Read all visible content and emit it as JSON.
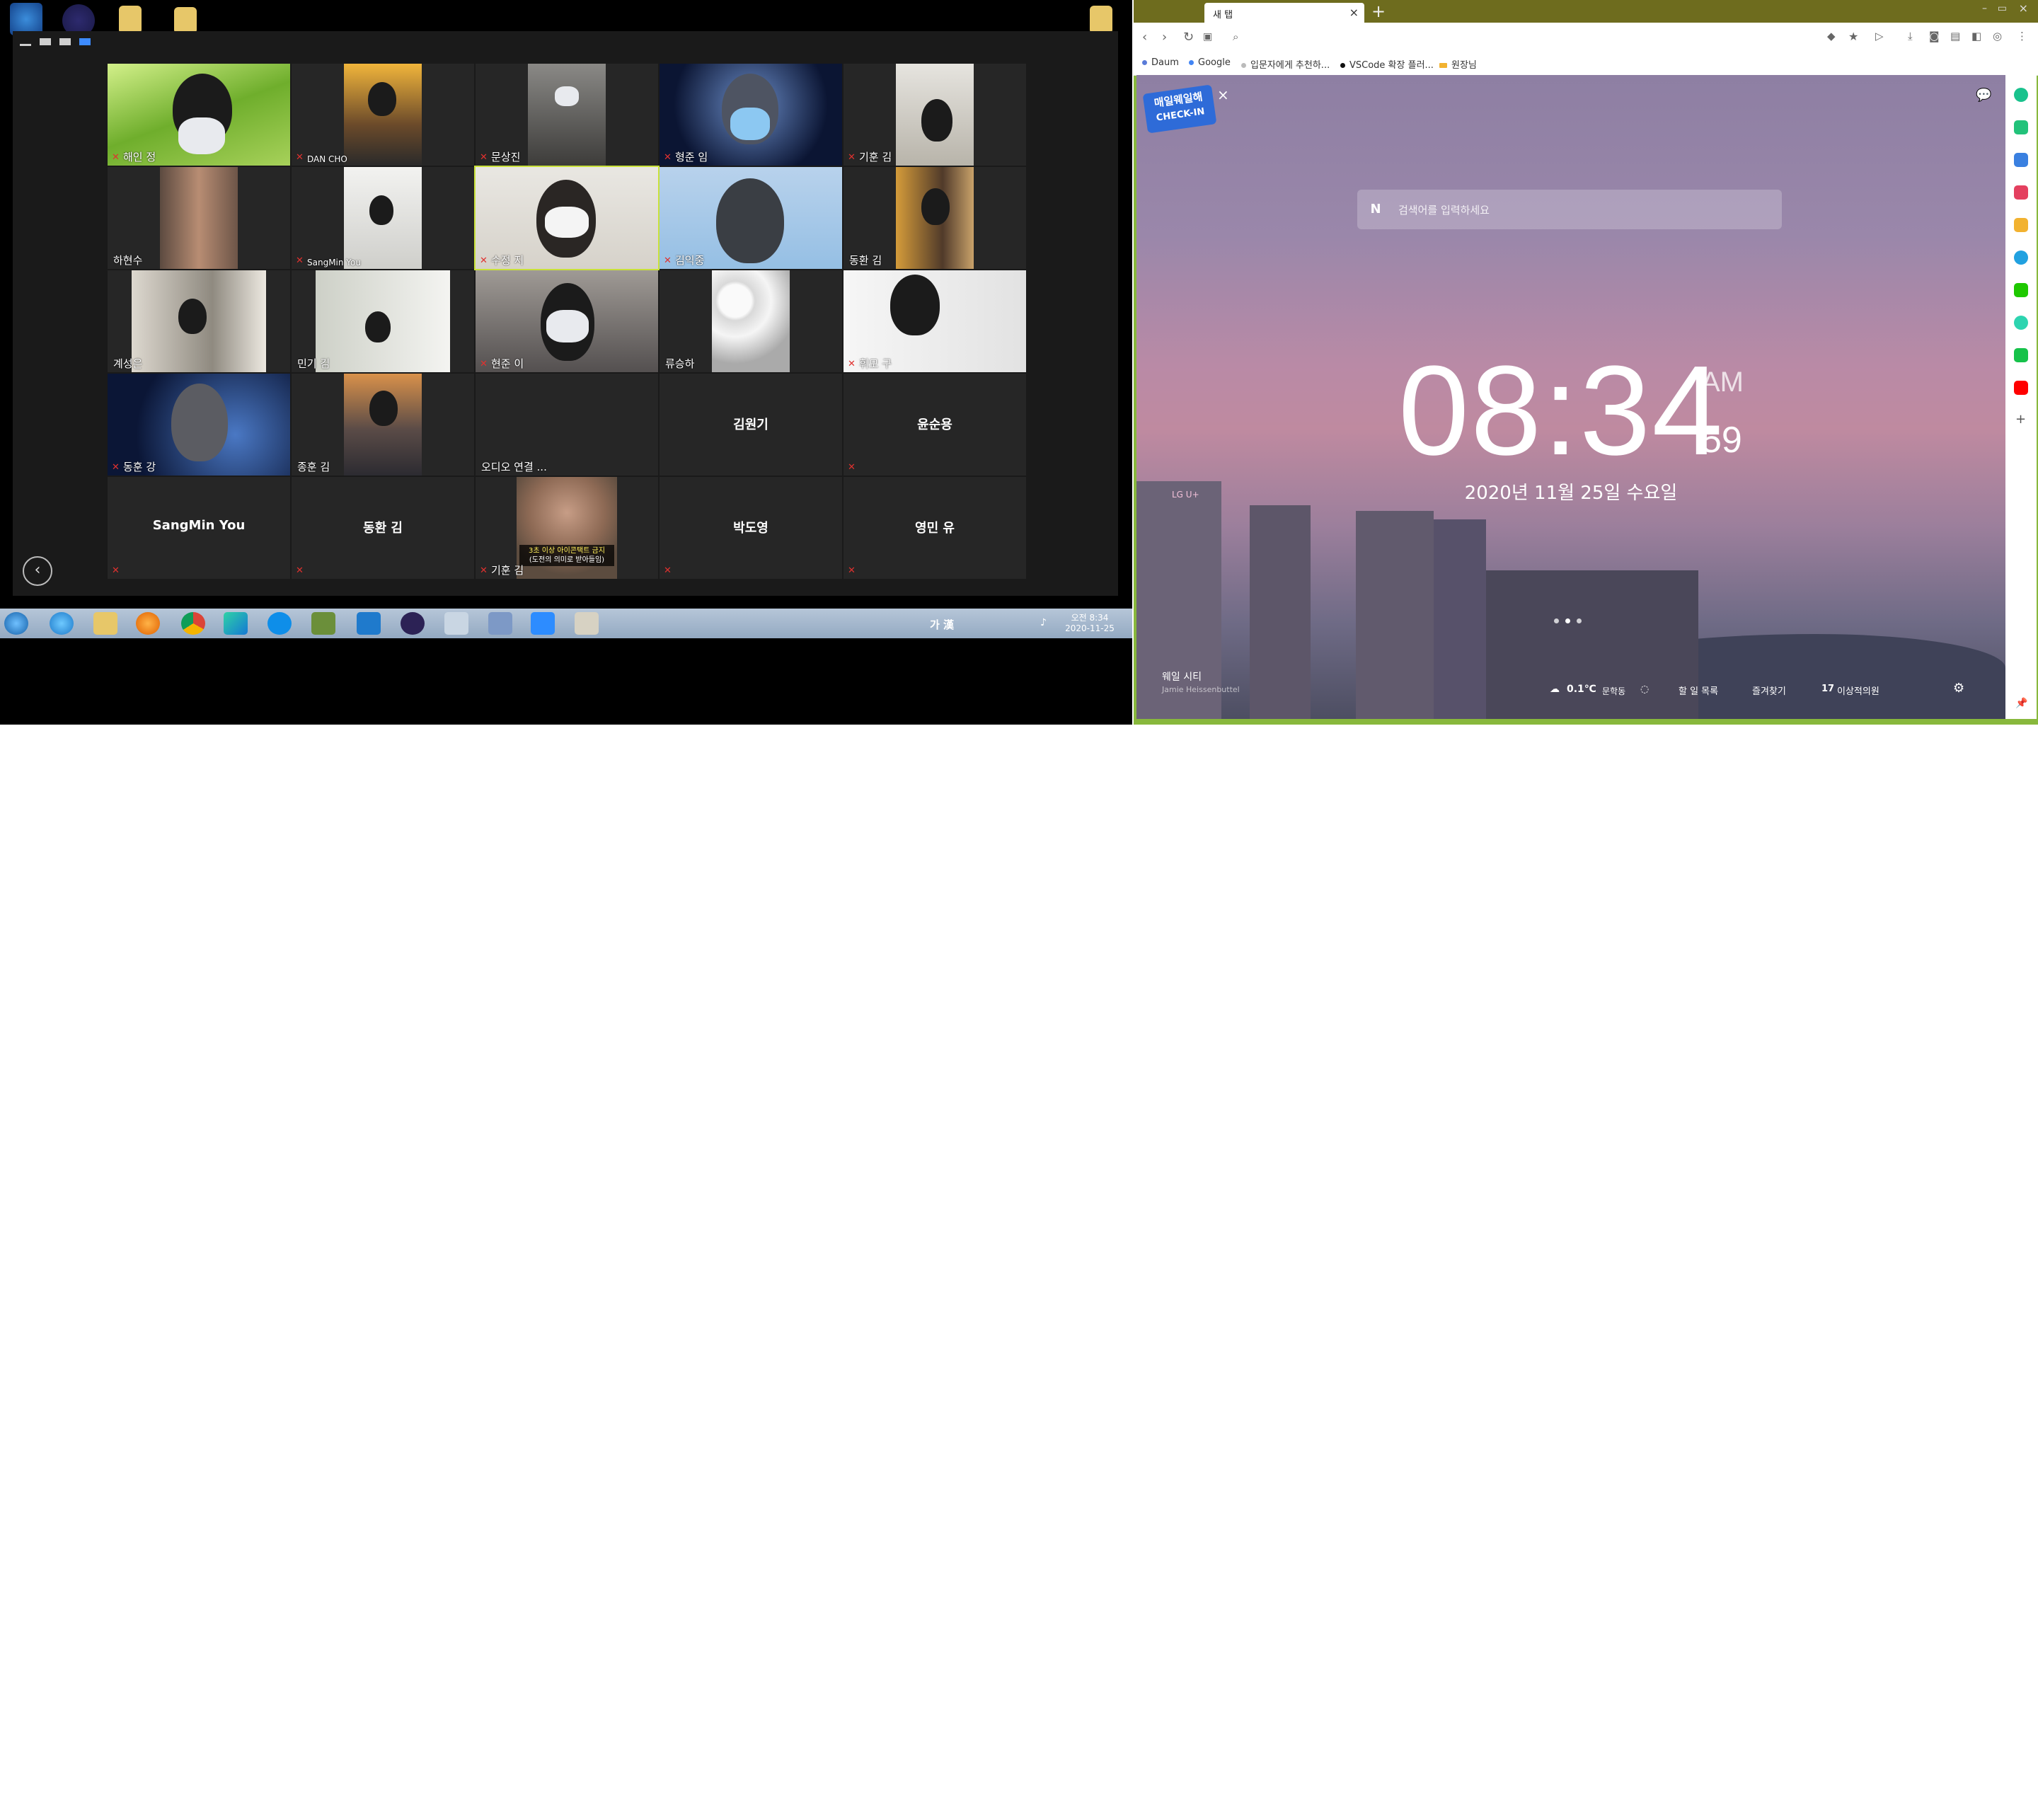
{
  "zoom": {
    "tiles": [
      {
        "name": "해인 정",
        "muted": true,
        "video": true
      },
      {
        "name": "DAN CHO",
        "muted": true,
        "video": true
      },
      {
        "name": "문상진",
        "muted": true,
        "video": true
      },
      {
        "name": "형준 임",
        "muted": true,
        "video": true
      },
      {
        "name": "기훈 김",
        "muted": true,
        "video": true
      },
      {
        "name": "하현수",
        "muted": false,
        "video": true
      },
      {
        "name": "SangMin You",
        "muted": true,
        "video": true
      },
      {
        "name": "수정 지",
        "muted": true,
        "video": true
      },
      {
        "name": "김익중",
        "muted": true,
        "video": true
      },
      {
        "name": "동환 김",
        "muted": false,
        "video": true
      },
      {
        "name": "계성은",
        "muted": false,
        "video": true
      },
      {
        "name": "민기 김",
        "muted": false,
        "video": true
      },
      {
        "name": "현준 이",
        "muted": true,
        "video": true
      },
      {
        "name": "류승하",
        "muted": false,
        "video": true
      },
      {
        "name": "휘모 구",
        "muted": true,
        "video": true
      },
      {
        "name": "동훈 강",
        "muted": true,
        "video": true
      },
      {
        "name": "종훈 김",
        "muted": false,
        "video": true
      },
      {
        "name": "오디오 연결 ...",
        "muted": false,
        "video": false
      },
      {
        "name": "김원기",
        "muted": false,
        "video": false,
        "center": true
      },
      {
        "name": "윤순용",
        "muted": true,
        "video": false,
        "center": true
      },
      {
        "name": "SangMin You",
        "muted": true,
        "video": false,
        "center": true
      },
      {
        "name": "동환 김",
        "muted": true,
        "video": false,
        "center": true
      },
      {
        "name": "기훈 김",
        "muted": true,
        "video": true
      },
      {
        "name": "박도영",
        "muted": true,
        "video": false,
        "center": true
      },
      {
        "name": "영민 유",
        "muted": true,
        "video": false,
        "center": true
      }
    ],
    "monkey_caption_1": "3초 이상 아이콘택트 금지",
    "monkey_caption_2": "(도전의 의미로 받아들임)"
  },
  "taskbar": {
    "ime": "가 漢",
    "time": "오전 8:34",
    "date": "2020-11-25"
  },
  "browser": {
    "tab_title": "새 탭",
    "new_tab_symbol": "+",
    "bookmarks": [
      "Daum",
      "Google",
      "입문자에게 추천하...",
      "VSCode 확장 플러...",
      "원장님"
    ],
    "search_placeholder": "검색어를 입력하세요",
    "search_logo": "N",
    "clock_hm": "08:34",
    "clock_ampm": "AM",
    "clock_sec": "59",
    "date": "2020년 11월 25일 수요일",
    "checkin_line1": "매일웨일해",
    "checkin_line2": "CHECK-IN",
    "photo_title": "웨일 시티",
    "photo_author": "Jamie Heissenbuttel",
    "weather_temp": "0.1℃",
    "weather_loc": "문학동",
    "todo": "할 일 목록",
    "favorites": "즐겨찾기",
    "day_count": "17",
    "schedule": "이상적의원"
  }
}
